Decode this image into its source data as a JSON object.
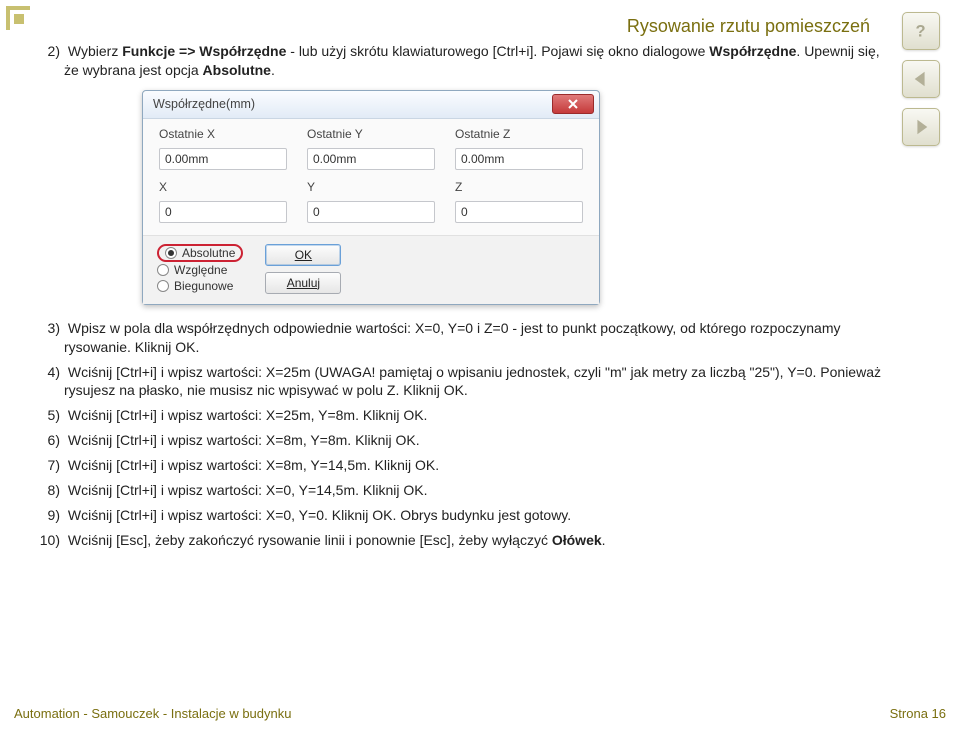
{
  "page": {
    "title": "Rysowanie rzutu pomieszczeń",
    "footer_left": "Automation - Samouczek - Instalacje w budynku",
    "footer_right": "Strona 16"
  },
  "steps": {
    "s2_num": "2)",
    "s2_a": "Wybierz ",
    "s2_b": "Funkcje => Współrzędne",
    "s2_c": " - lub użyj skrótu klawiaturowego [Ctrl+i]. Pojawi się okno dialogowe ",
    "s2_d": "Współrzędne",
    "s2_e": ". Upewnij się, że wybrana jest opcja ",
    "s2_f": "Absolutne",
    "s2_g": ".",
    "s3_num": "3)",
    "s3": "Wpisz w pola dla współrzędnych odpowiednie wartości: X=0, Y=0 i Z=0 - jest to punkt początkowy, od którego rozpoczynamy rysowanie. Kliknij OK.",
    "s4_num": "4)",
    "s4": "Wciśnij [Ctrl+i] i wpisz wartości: X=25m (UWAGA! pamiętaj o wpisaniu jednostek, czyli \"m\" jak metry za liczbą \"25\"), Y=0. Ponieważ rysujesz na płasko, nie musisz nic wpisywać w polu Z. Kliknij OK.",
    "s5_num": "5)",
    "s5": "Wciśnij [Ctrl+i] i wpisz wartości: X=25m, Y=8m. Kliknij OK.",
    "s6_num": "6)",
    "s6": "Wciśnij [Ctrl+i] i wpisz wartości: X=8m, Y=8m. Kliknij OK.",
    "s7_num": "7)",
    "s7": "Wciśnij [Ctrl+i] i wpisz wartości: X=8m, Y=14,5m. Kliknij OK.",
    "s8_num": "8)",
    "s8": "Wciśnij [Ctrl+i] i wpisz wartości: X=0, Y=14,5m. Kliknij OK.",
    "s9_num": "9)",
    "s9": "Wciśnij [Ctrl+i] i wpisz wartości: X=0, Y=0. Kliknij OK. Obrys budynku jest gotowy.",
    "s10_num": "10)",
    "s10_a": "Wciśnij [Esc], żeby zakończyć rysowanie linii i ponownie [Esc], żeby wyłączyć ",
    "s10_b": "Ołówek",
    "s10_c": "."
  },
  "dialog": {
    "title": "Współrzędne(mm)",
    "headers": {
      "lx": "Ostatnie X",
      "ly": "Ostatnie Y",
      "lz": "Ostatnie Z",
      "x": "X",
      "y": "Y",
      "z": "Z"
    },
    "values": {
      "lx": "0.00mm",
      "ly": "0.00mm",
      "lz": "0.00mm",
      "x": "0",
      "y": "0",
      "z": "0"
    },
    "radios": {
      "abs": "Absolutne",
      "rel": "Względne",
      "pol": "Biegunowe"
    },
    "buttons": {
      "ok": "OK",
      "cancel": "Anuluj"
    }
  }
}
